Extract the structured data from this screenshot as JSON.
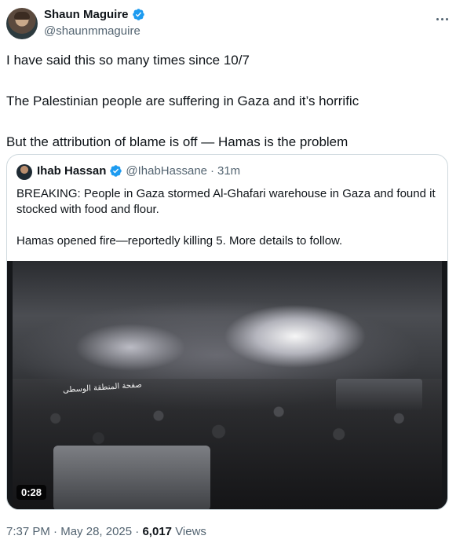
{
  "author": {
    "display_name": "Shaun Maguire",
    "handle": "@shaunmmaguire",
    "verified": true
  },
  "tweet": {
    "text": "I have said this so many times since 10/7\n\nThe Palestinian people are suffering in Gaza and it’s horrific\n\nBut the attribution of blame is off — Hamas is the problem"
  },
  "quoted_tweet": {
    "display_name": "Ihab Hassan",
    "handle": "@IhabHassane",
    "separator": "·",
    "time_ago": "31m",
    "text": "BREAKING: People in Gaza stormed Al-Ghafari warehouse in Gaza and found it stocked with food and flour.\n\nHamas opened fire—reportedly killing 5. More details to follow.",
    "media": {
      "type": "video",
      "duration": "0:28",
      "watermark": "صفحة المنطقة الوسطى"
    }
  },
  "meta": {
    "time": "7:37 PM",
    "date": "May 28, 2025",
    "separator": "·",
    "views_count": "6,017",
    "views_label": "Views"
  },
  "colors": {
    "verified_blue": "#1d9bf0",
    "text_primary": "#0f1419",
    "text_secondary": "#536471",
    "border": "#cfd9de"
  },
  "icons": {
    "verified": "verified-badge-icon",
    "more": "more-options-icon"
  }
}
